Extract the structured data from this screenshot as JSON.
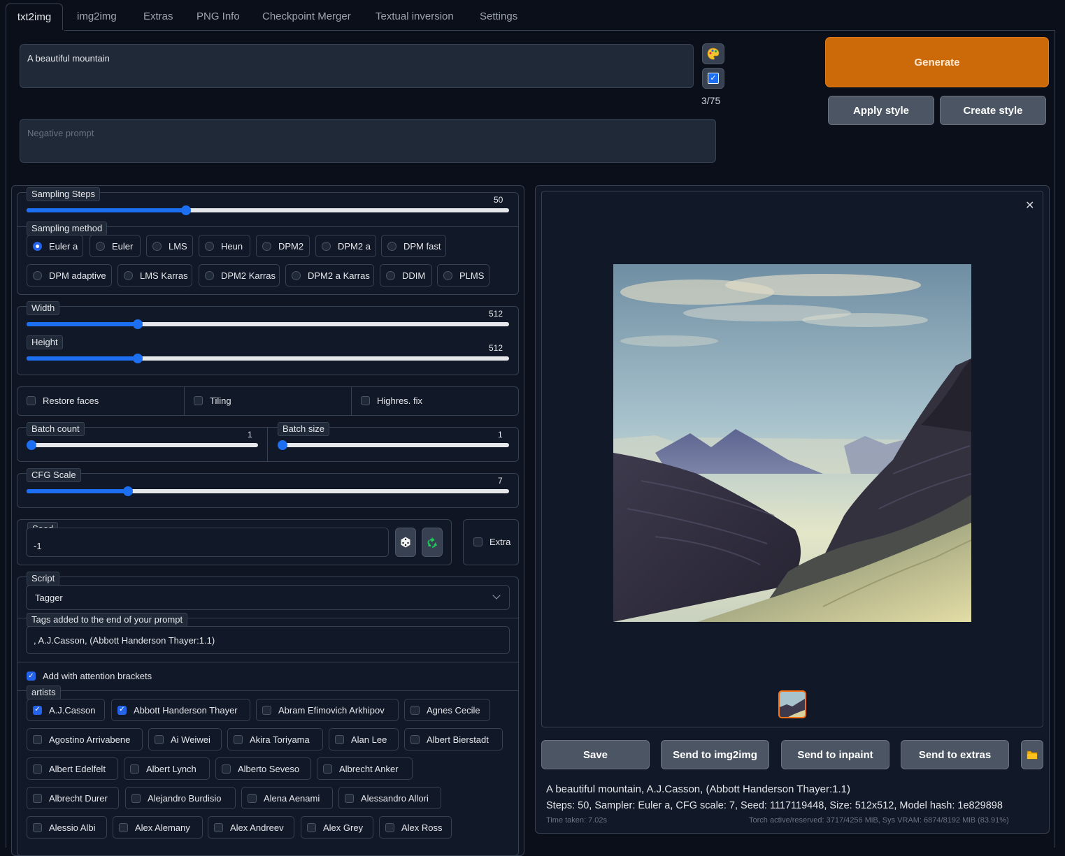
{
  "tabs": [
    "txt2img",
    "img2img",
    "Extras",
    "PNG Info",
    "Checkpoint Merger",
    "Textual inversion",
    "Settings"
  ],
  "prompt": {
    "value": "A beautiful mountain",
    "token_count": "3/75"
  },
  "negative_prompt": {
    "placeholder": "Negative prompt",
    "value": ""
  },
  "actions": {
    "generate": "Generate",
    "apply_style": "Apply style",
    "create_style": "Create style"
  },
  "sampling_steps": {
    "label": "Sampling Steps",
    "value": 50,
    "min": 1,
    "max": 150
  },
  "sampling_method": {
    "label": "Sampling method",
    "selected": "Euler a",
    "options": [
      "Euler a",
      "Euler",
      "LMS",
      "Heun",
      "DPM2",
      "DPM2 a",
      "DPM fast",
      "DPM adaptive",
      "LMS Karras",
      "DPM2 Karras",
      "DPM2 a Karras",
      "DDIM",
      "PLMS"
    ]
  },
  "width": {
    "label": "Width",
    "value": 512,
    "min": 64,
    "max": 2048
  },
  "height": {
    "label": "Height",
    "value": 512,
    "min": 64,
    "max": 2048
  },
  "toggles": {
    "restore_faces": "Restore faces",
    "tiling": "Tiling",
    "highres_fix": "Highres. fix"
  },
  "batch_count": {
    "label": "Batch count",
    "value": 1,
    "min": 1,
    "max": 100
  },
  "batch_size": {
    "label": "Batch size",
    "value": 1,
    "min": 1,
    "max": 8
  },
  "cfg_scale": {
    "label": "CFG Scale",
    "value": 7,
    "min": 1,
    "max": 30
  },
  "seed": {
    "label": "Seed",
    "value": "-1",
    "extra_label": "Extra"
  },
  "script": {
    "label": "Script",
    "selected": "Tagger",
    "tags_label": "Tags added to the end of your prompt",
    "tags_value": ", A.J.Casson, (Abbott Handerson Thayer:1.1)",
    "attention_label": "Add with attention brackets",
    "attention_checked": true,
    "artists_label": "artists",
    "artists": [
      {
        "name": "A.J.Casson",
        "checked": true
      },
      {
        "name": "Abbott Handerson Thayer",
        "checked": true
      },
      {
        "name": "Abram Efimovich Arkhipov",
        "checked": false
      },
      {
        "name": "Agnes Cecile",
        "checked": false
      },
      {
        "name": "Agostino Arrivabene",
        "checked": false
      },
      {
        "name": "Ai Weiwei",
        "checked": false
      },
      {
        "name": "Akira Toriyama",
        "checked": false
      },
      {
        "name": "Alan Lee",
        "checked": false
      },
      {
        "name": "Albert Bierstadt",
        "checked": false
      },
      {
        "name": "Albert Edelfelt",
        "checked": false
      },
      {
        "name": "Albert Lynch",
        "checked": false
      },
      {
        "name": "Alberto Seveso",
        "checked": false
      },
      {
        "name": "Albrecht Anker",
        "checked": false
      },
      {
        "name": "Albrecht Durer",
        "checked": false
      },
      {
        "name": "Alejandro Burdisio",
        "checked": false
      },
      {
        "name": "Alena Aenami",
        "checked": false
      },
      {
        "name": "Alessandro Allori",
        "checked": false
      },
      {
        "name": "Alessio Albi",
        "checked": false
      },
      {
        "name": "Alex Alemany",
        "checked": false
      },
      {
        "name": "Alex Andreev",
        "checked": false
      },
      {
        "name": "Alex Grey",
        "checked": false
      },
      {
        "name": "Alex Ross",
        "checked": false
      }
    ]
  },
  "output": {
    "buttons": {
      "save": "Save",
      "send_img2img": "Send to img2img",
      "send_inpaint": "Send to inpaint",
      "send_extras": "Send to extras"
    },
    "info_line1": "A beautiful mountain, A.J.Casson, (Abbott Handerson Thayer:1.1)",
    "info_line2": "Steps: 50, Sampler: Euler a, CFG scale: 7, Seed: 1117119448, Size: 512x512, Model hash: 1e829898",
    "time_taken": "Time taken: 7.02s",
    "vram": "Torch active/reserved: 3717/4256 MiB, Sys VRAM: 6874/8192 MiB (83.91%)"
  },
  "colors": {
    "accent": "#1d6ff2",
    "generate": "#cc6a0a",
    "background": "#0b0f19"
  }
}
